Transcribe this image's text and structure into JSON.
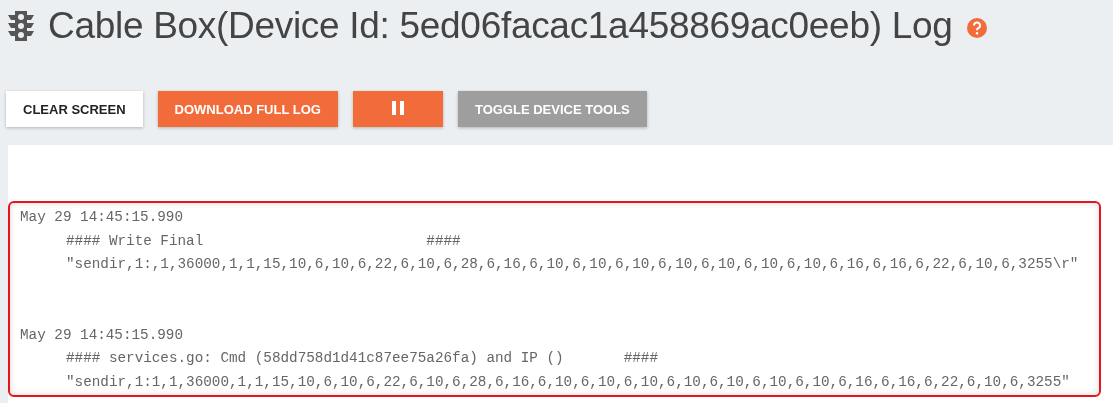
{
  "header": {
    "title": "Cable Box(Device Id: 5ed06facac1a458869ac0eeb) Log"
  },
  "buttons": [
    {
      "kind": "plain",
      "label": "CLEAR SCREEN"
    },
    {
      "kind": "primary",
      "label": "DOWNLOAD FULL LOG"
    },
    {
      "kind": "pause"
    },
    {
      "kind": "secondary",
      "label": "TOGGLE DEVICE TOOLS"
    }
  ],
  "log": {
    "entries": [
      {
        "timestamp": "May 29 14:45:15.990",
        "lines": [
          "#### Write Final                          ####",
          "\"sendir,1:,1,36000,1,1,15,10,6,10,6,22,6,10,6,28,6,16,6,10,6,10,6,10,6,10,6,10,6,10,6,10,6,16,6,16,6,22,6,10,6,3255\\r\""
        ]
      },
      {
        "timestamp": "May 29 14:45:15.990",
        "lines": [
          "#### services.go: Cmd (58dd758d1d41c87ee75a26fa) and IP ()       ####",
          "\"sendir,1:1,1,36000,1,1,15,10,6,10,6,22,6,10,6,28,6,16,6,10,6,10,6,10,6,10,6,10,6,10,6,10,6,16,6,16,6,22,6,10,6,3255\""
        ]
      }
    ]
  }
}
